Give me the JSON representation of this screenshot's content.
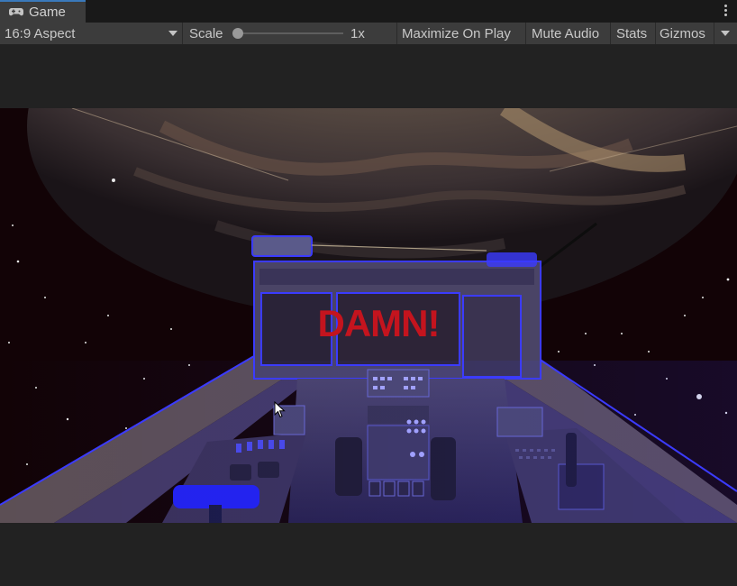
{
  "tab": {
    "label": "Game",
    "icon": "gamepad-icon"
  },
  "toolbar": {
    "aspect": "16:9 Aspect",
    "scale_label": "Scale",
    "scale_value": "1x",
    "scale_slider": 0,
    "maximize_on_play": "Maximize On Play",
    "mute_audio": "Mute Audio",
    "stats": "Stats",
    "gizmos": "Gizmos"
  },
  "game": {
    "overlay_text": "DAMN!"
  },
  "colors": {
    "accent_tab": "#3a79bb",
    "overlay_text": "#c4141e",
    "cockpit_glow": "#3b3bff"
  }
}
